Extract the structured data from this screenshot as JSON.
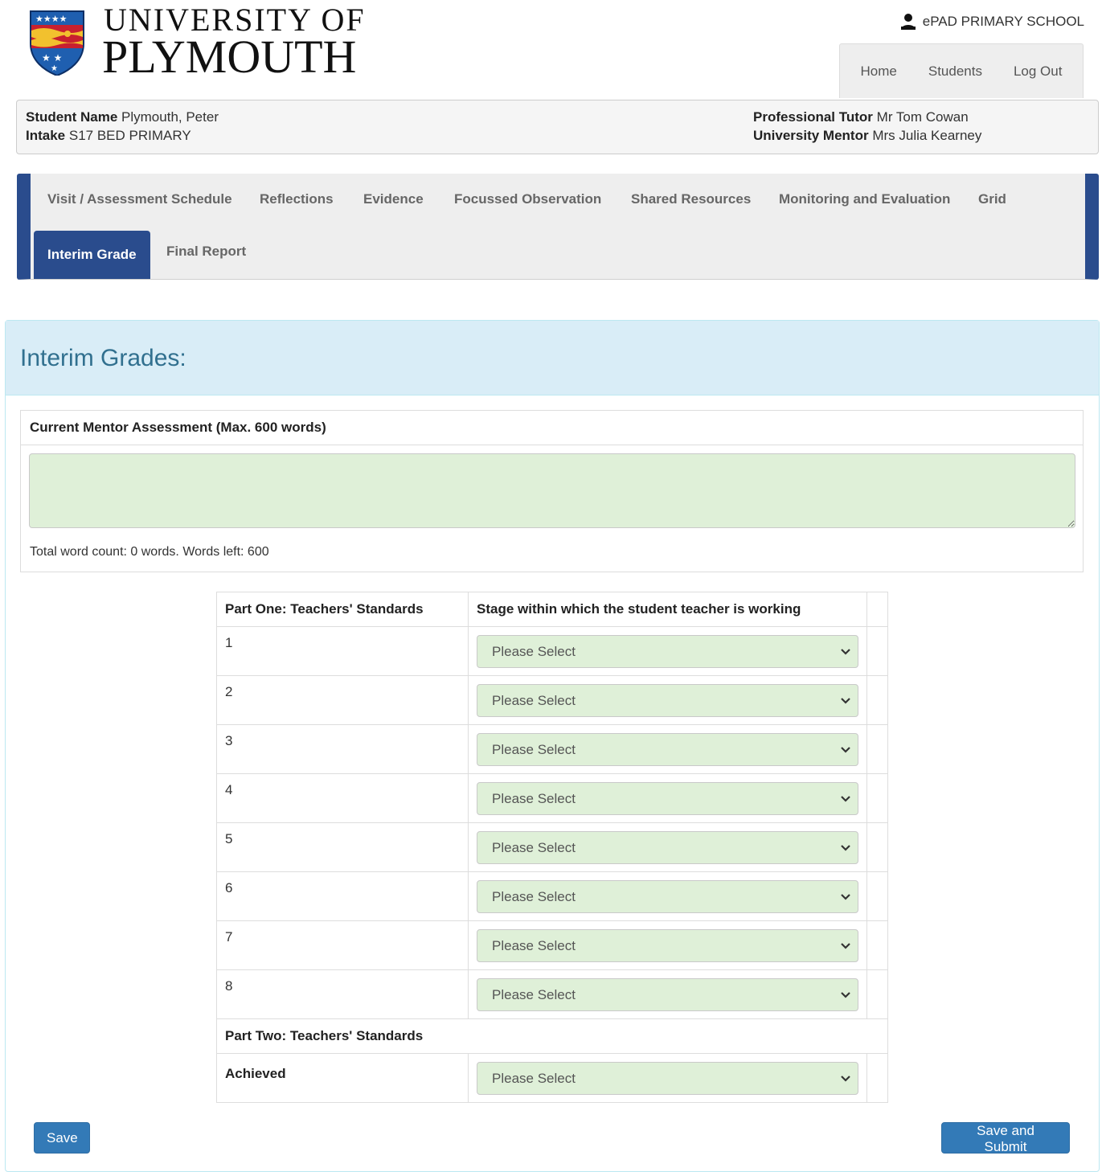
{
  "brand": {
    "line1": "UNIVERSITY OF",
    "line2": "PLYMOUTH",
    "colors": {
      "navy": "#2a4c8d",
      "crest_red": "#c8202f",
      "crest_gold": "#f2c12e",
      "crest_blue": "#1f5fb0"
    }
  },
  "header": {
    "school_name": "ePAD PRIMARY SCHOOL",
    "nav": [
      "Home",
      "Students",
      "Log Out"
    ]
  },
  "student": {
    "name_label": "Student Name",
    "name_value": "Plymouth, Peter",
    "intake_label": "Intake",
    "intake_value": "S17 BED PRIMARY",
    "tutor_label": "Professional Tutor",
    "tutor_value": "Mr Tom Cowan",
    "mentor_label": "University Mentor",
    "mentor_value": "Mrs Julia Kearney"
  },
  "tabs": [
    "Visit / Assessment Schedule",
    "Reflections",
    "Evidence",
    "Focussed Observation",
    "Shared Resources",
    "Monitoring and Evaluation",
    "Grid",
    "Interim Grade",
    "Final Report"
  ],
  "active_tab": "Interim Grade",
  "page": {
    "heading": "Interim Grades:",
    "mentor_assessment_heading": "Current Mentor Assessment (Max. 600 words)",
    "mentor_assessment_value": "",
    "word_count": "Total word count: 0 words. Words left: 600"
  },
  "table": {
    "part_one_header": "Part One: Teachers' Standards",
    "stage_header": "Stage within which the student teacher is working",
    "rows": [
      {
        "num": "1",
        "selected": "Please Select"
      },
      {
        "num": "2",
        "selected": "Please Select"
      },
      {
        "num": "3",
        "selected": "Please Select"
      },
      {
        "num": "4",
        "selected": "Please Select"
      },
      {
        "num": "5",
        "selected": "Please Select"
      },
      {
        "num": "6",
        "selected": "Please Select"
      },
      {
        "num": "7",
        "selected": "Please Select"
      },
      {
        "num": "8",
        "selected": "Please Select"
      }
    ],
    "part_two_header": "Part Two: Teachers' Standards",
    "achieved_label": "Achieved",
    "achieved_selected": "Please Select"
  },
  "buttons": {
    "save": "Save",
    "submit": "Save and Submit"
  }
}
